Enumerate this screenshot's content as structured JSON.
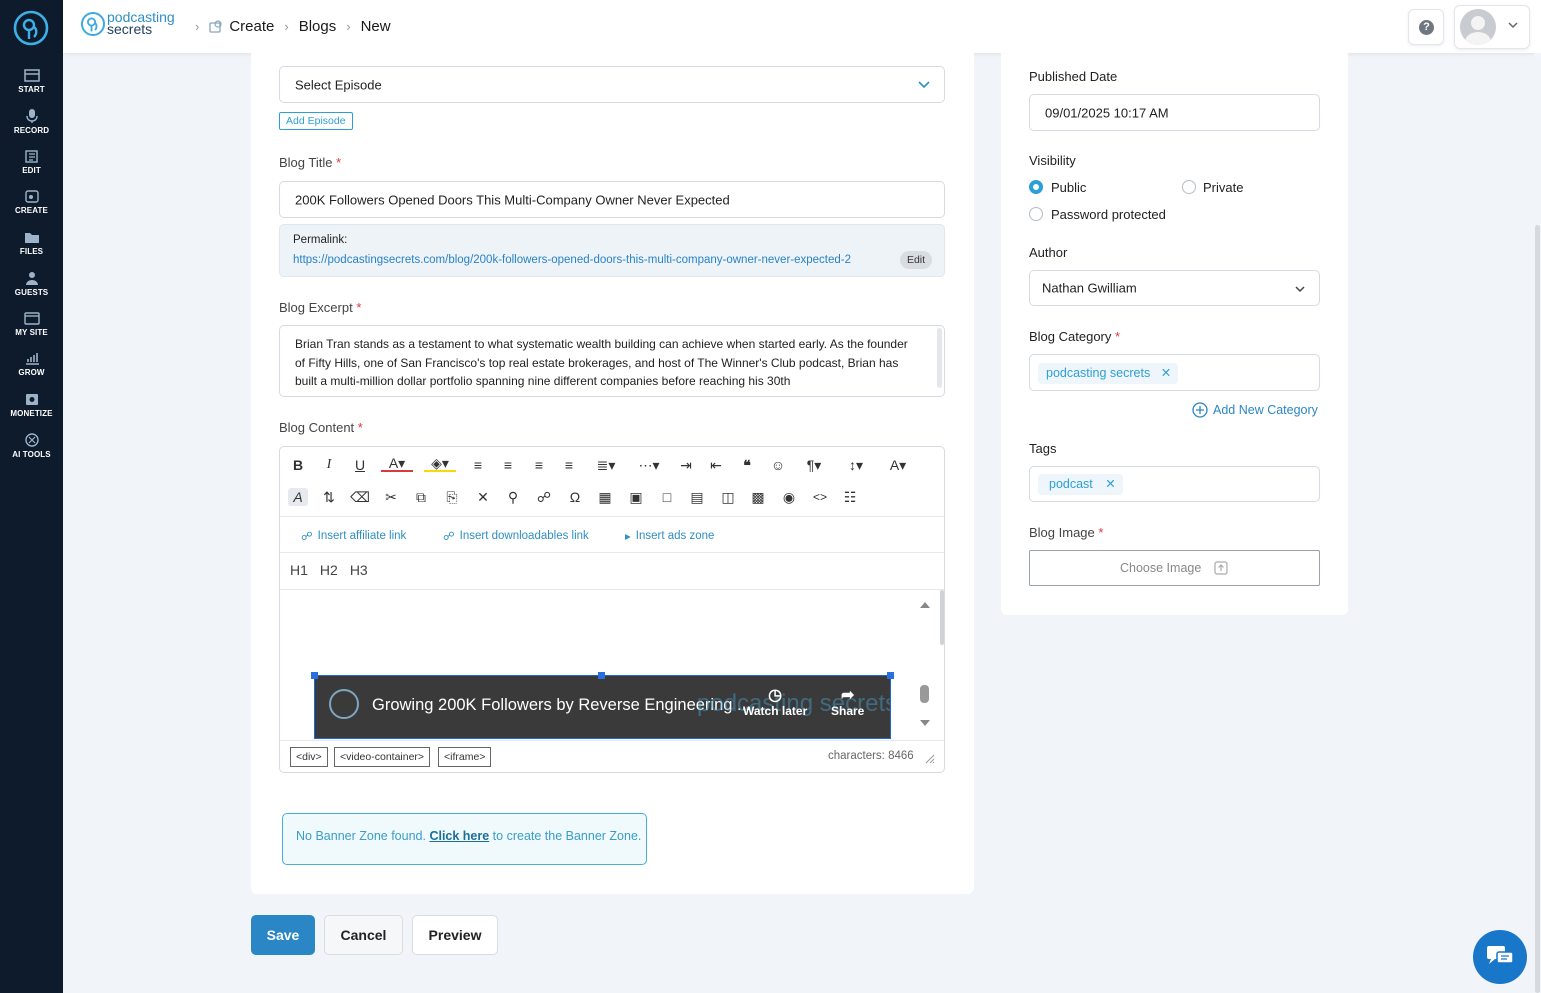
{
  "sidebar": {
    "items": [
      {
        "label": "START",
        "icon": "start-icon"
      },
      {
        "label": "RECORD",
        "icon": "microphone-icon"
      },
      {
        "label": "EDIT",
        "icon": "edit-icon"
      },
      {
        "label": "CREATE",
        "icon": "create-icon"
      },
      {
        "label": "FILES",
        "icon": "folder-icon"
      },
      {
        "label": "GUESTS",
        "icon": "guests-icon"
      },
      {
        "label": "MY SITE",
        "icon": "site-icon"
      },
      {
        "label": "GROW",
        "icon": "chart-icon"
      },
      {
        "label": "MONETIZE",
        "icon": "monetize-icon"
      },
      {
        "label": "AI TOOLS",
        "icon": "ai-icon"
      }
    ]
  },
  "header": {
    "brand_line1": "podcasting",
    "brand_line2": "secrets",
    "breadcrumb": [
      "Create",
      "Blogs",
      "New"
    ],
    "help_label": "?"
  },
  "form": {
    "episode": {
      "value": "Select Episode",
      "add_label": "Add Episode"
    },
    "title": {
      "label": "Blog Title",
      "value": "200K Followers Opened Doors This Multi-Company Owner  Never Expected"
    },
    "permalink": {
      "label": "Permalink:",
      "url": "https://podcastingsecrets.com/blog/200k-followers-opened-doors-this-multi-company-owner-never-expected-2",
      "edit_label": "Edit"
    },
    "excerpt": {
      "label": "Blog Excerpt",
      "value": "Brian Tran stands as a testament to what systematic wealth building can achieve when started early. As the founder of Fifty Hills, one of San Francisco's top real estate brokerages, and host of The Winner's Club podcast, Brian has built a multi-million dollar portfolio spanning nine different companies before reaching his 30th"
    },
    "content_label": "Blog Content",
    "required_mark": "*"
  },
  "editor": {
    "insert_links": [
      "Insert affiliate link",
      "Insert downloadables link",
      "Insert ads zone"
    ],
    "headings": [
      "H1",
      "H2",
      "H3"
    ],
    "video": {
      "title": "Growing 200K Followers by Reverse Engineering ...",
      "watch_later": "Watch later",
      "share": "Share",
      "watermark": "podcasting secrets"
    },
    "path_tags": [
      "<div>",
      "<video-container>",
      "<iframe>"
    ],
    "characters": "characters: 8466"
  },
  "banner": {
    "prefix": "No Banner Zone found. ",
    "link": "Click here",
    "suffix": " to create the Banner Zone."
  },
  "actions": {
    "save": "Save",
    "cancel": "Cancel",
    "preview": "Preview"
  },
  "right": {
    "published_label": "Published Date",
    "published_value": "09/01/2025 10:17 AM",
    "visibility_label": "Visibility",
    "visibility_options": [
      "Public",
      "Private",
      "Password protected"
    ],
    "visibility_selected": "Public",
    "author_label": "Author",
    "author_value": "Nathan Gwilliam",
    "category_label": "Blog Category",
    "category_chip": "podcasting secrets",
    "add_category": "Add New Category",
    "tags_label": "Tags",
    "tag_chip": "podcast",
    "image_label": "Blog Image",
    "image_button": "Choose Image"
  },
  "colors": {
    "accent": "#2a86c4",
    "sidebar": "#0d1b2c",
    "required": "#e0353b"
  }
}
